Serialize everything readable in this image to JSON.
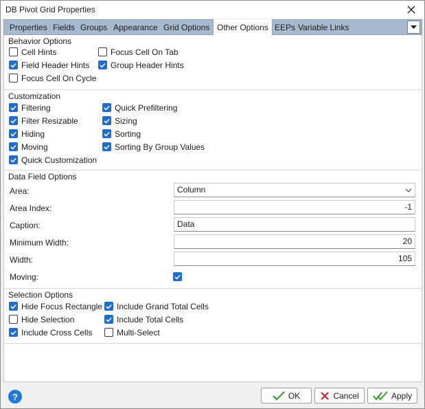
{
  "window": {
    "title": "DB Pivot Grid Properties",
    "close_icon": "close-icon"
  },
  "tabs": [
    {
      "label": "Properties",
      "active": false
    },
    {
      "label": "Fields",
      "active": false
    },
    {
      "label": "Groups",
      "active": false
    },
    {
      "label": "Appearance",
      "active": false
    },
    {
      "label": "Grid Options",
      "active": false
    },
    {
      "label": "Other Options",
      "active": true
    },
    {
      "label": "EEPs",
      "active": false
    },
    {
      "label": "Variable Links",
      "active": false
    }
  ],
  "behavior": {
    "title": "Behavior Options",
    "items": [
      {
        "label": "Cell Hints",
        "checked": false
      },
      {
        "label": "Focus Cell On Tab",
        "checked": false
      },
      {
        "label": "Field Header Hints",
        "checked": true
      },
      {
        "label": "Group Header Hints",
        "checked": true
      },
      {
        "label": "Focus Cell On Cycle",
        "checked": false
      }
    ]
  },
  "customization": {
    "title": "Customization",
    "items": [
      {
        "label": "Filtering",
        "checked": true
      },
      {
        "label": "Quick Prefiltering",
        "checked": true
      },
      {
        "label": "Filter Resizable",
        "checked": true
      },
      {
        "label": "Sizing",
        "checked": true
      },
      {
        "label": "Hiding",
        "checked": true
      },
      {
        "label": "Sorting",
        "checked": true
      },
      {
        "label": "Moving",
        "checked": true
      },
      {
        "label": "Sorting By Group Values",
        "checked": true
      },
      {
        "label": "Quick Customization",
        "checked": true
      }
    ]
  },
  "data_field": {
    "title": "Data Field Options",
    "area": {
      "label": "Area:",
      "value": "Column"
    },
    "area_index": {
      "label": "Area Index:",
      "value": "-1"
    },
    "caption": {
      "label": "Caption:",
      "value": "Data"
    },
    "min_width": {
      "label": "Minimum Width:",
      "value": "20"
    },
    "width": {
      "label": "Width:",
      "value": "105"
    },
    "moving": {
      "label": "Moving:",
      "checked": true
    }
  },
  "selection": {
    "title": "Selection Options",
    "items": [
      {
        "label": "Hide Focus Rectangle",
        "checked": true
      },
      {
        "label": "Include Grand Total Cells",
        "checked": true
      },
      {
        "label": "Hide Selection",
        "checked": false
      },
      {
        "label": "Include Total Cells",
        "checked": true
      },
      {
        "label": "Include Cross Cells",
        "checked": true
      },
      {
        "label": "Multi-Select",
        "checked": false
      }
    ]
  },
  "footer": {
    "help_label": "?",
    "ok_label": "OK",
    "cancel_label": "Cancel",
    "apply_label": "Apply"
  },
  "colors": {
    "accent": "#1f6cd1",
    "tab_strip": "#a7b9cf",
    "ok_check": "#3a9a2c",
    "cancel_x": "#d0262d"
  }
}
